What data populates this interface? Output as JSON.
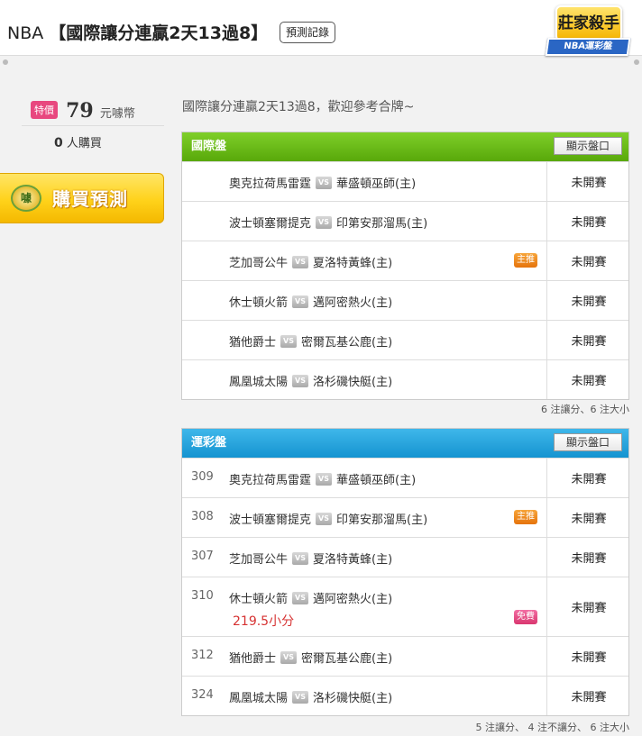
{
  "header": {
    "league": "NBA",
    "headline": "【國際讓分連贏2天13過8】",
    "record_button": "預測記錄",
    "brand_title": "莊家殺手",
    "brand_ribbon": "NBA運彩盤"
  },
  "sidebar": {
    "special_badge": "特價",
    "price": "79",
    "price_unit": "元噱幣",
    "buyers_count": "0",
    "buyers_label": "人購買",
    "buy_icon": "噱",
    "buy_label": "購買預測"
  },
  "intro": "國際讓分連贏2天13過8，歡迎參考合牌~",
  "intl_panel": {
    "title": "國際盤",
    "show_button": "顯示盤口",
    "vs_label": "VS",
    "games": [
      {
        "away": "奧克拉荷馬雷霆",
        "home": "華盛頓巫師(主)",
        "tag": "",
        "status": "未開賽"
      },
      {
        "away": "波士頓塞爾提克",
        "home": "印第安那溜馬(主)",
        "tag": "",
        "status": "未開賽"
      },
      {
        "away": "芝加哥公牛",
        "home": "夏洛特黃蜂(主)",
        "tag": "主推",
        "status": "未開賽"
      },
      {
        "away": "休士頓火箭",
        "home": "邁阿密熱火(主)",
        "tag": "",
        "status": "未開賽"
      },
      {
        "away": "猶他爵士",
        "home": "密爾瓦基公鹿(主)",
        "tag": "",
        "status": "未開賽"
      },
      {
        "away": "鳳凰城太陽",
        "home": "洛杉磯快艇(主)",
        "tag": "",
        "status": "未開賽"
      }
    ],
    "footnote": "6 注讓分、6 注大小"
  },
  "lottery_panel": {
    "title": "運彩盤",
    "show_button": "顯示盤口",
    "vs_label": "VS",
    "games": [
      {
        "code": "309",
        "away": "奧克拉荷馬雷霆",
        "home": "華盛頓巫師(主)",
        "tag": "",
        "pick": "",
        "status": "未開賽"
      },
      {
        "code": "308",
        "away": "波士頓塞爾提克",
        "home": "印第安那溜馬(主)",
        "tag": "主推",
        "pick": "",
        "status": "未開賽"
      },
      {
        "code": "307",
        "away": "芝加哥公牛",
        "home": "夏洛特黃蜂(主)",
        "tag": "",
        "pick": "",
        "status": "未開賽"
      },
      {
        "code": "310",
        "away": "休士頓火箭",
        "home": "邁阿密熱火(主)",
        "tag": "免費",
        "pick": "219.5小分",
        "status": "未開賽"
      },
      {
        "code": "312",
        "away": "猶他爵士",
        "home": "密爾瓦基公鹿(主)",
        "tag": "",
        "pick": "",
        "status": "未開賽"
      },
      {
        "code": "324",
        "away": "鳳凰城太陽",
        "home": "洛杉磯快艇(主)",
        "tag": "",
        "pick": "",
        "status": "未開賽"
      }
    ],
    "footnote": "5 注讓分、 4 注不讓分、 6 注大小"
  }
}
